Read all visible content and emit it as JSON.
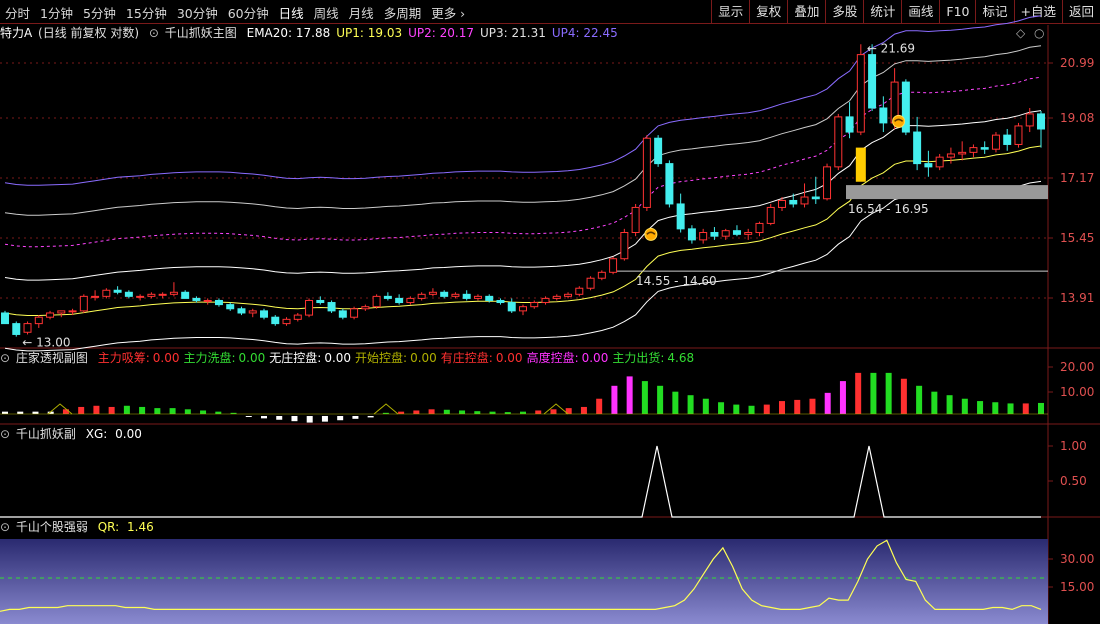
{
  "toolbar": {
    "periods": [
      "分时",
      "1分钟",
      "5分钟",
      "15分钟",
      "30分钟",
      "60分钟",
      "日线",
      "周线",
      "月线",
      "多周期",
      "更多"
    ],
    "active_period": "日线",
    "right_buttons": [
      "显示",
      "复权",
      "叠加",
      "多股",
      "统计",
      "画线",
      "F10",
      "标记",
      "+自选",
      "返回"
    ]
  },
  "main_pane": {
    "stock_label": "特力A",
    "mode": "(日线 前复权 对数)",
    "indicator_name": "千山抓妖主图",
    "legend": [
      {
        "name": "EMA20",
        "value": "17.88",
        "color": "#ffffff"
      },
      {
        "name": "UP1",
        "value": "19.03",
        "color": "#ffff55"
      },
      {
        "name": "UP2",
        "value": "20.17",
        "color": "#ff44ff"
      },
      {
        "name": "UP3",
        "value": "21.31",
        "color": "#e0e0e0"
      },
      {
        "name": "UP4",
        "value": "22.45",
        "color": "#8a6cff"
      }
    ],
    "price_axis": [
      "20.99",
      "19.08",
      "17.17",
      "15.45",
      "13.91"
    ],
    "annotations": {
      "high_label": "21.69",
      "low_label": "13.00",
      "zone1": "14.55 - 14.60",
      "zone2": "16.54 - 16.95"
    }
  },
  "pane2": {
    "name": "庄家透视副图",
    "items": [
      {
        "label": "主力吸筹",
        "value": "0.00",
        "color": "#ff3030"
      },
      {
        "label": "主力洗盘",
        "value": "0.00",
        "color": "#33dd33"
      },
      {
        "label": "无庄控盘",
        "value": "0.00",
        "color": "#ffffff"
      },
      {
        "label": "开始控盘",
        "value": "0.00",
        "color": "#b0b000"
      },
      {
        "label": "有庄控盘",
        "value": "0.00",
        "color": "#ff3030"
      },
      {
        "label": "高度控盘",
        "value": "0.00",
        "color": "#ff33ff"
      },
      {
        "label": "主力出货",
        "value": "4.68",
        "color": "#33dd33"
      }
    ],
    "axis": [
      "20.00",
      "10.00"
    ]
  },
  "pane3": {
    "name": "千山抓妖副",
    "item": {
      "label": "XG",
      "value": "0.00",
      "color": "#ffffff"
    },
    "axis": [
      "1.00",
      "0.50"
    ]
  },
  "pane4": {
    "name": "千山个股强弱",
    "item": {
      "label": "QR",
      "value": "1.46",
      "color": "#ffff55"
    },
    "axis": [
      "30.00",
      "15.00"
    ]
  },
  "colors": {
    "up_candle": "#ff3333",
    "down_candle": "#44eeee",
    "border": "#7a1a1a",
    "ema": "#ffffff"
  },
  "chart_data": {
    "type": "candlestick",
    "ohlc": [
      [
        13.55,
        13.6,
        13.3,
        13.3
      ],
      [
        13.3,
        13.35,
        13.0,
        13.05
      ],
      [
        13.1,
        13.35,
        13.05,
        13.3
      ],
      [
        13.3,
        13.5,
        13.2,
        13.45
      ],
      [
        13.45,
        13.6,
        13.4,
        13.55
      ],
      [
        13.55,
        13.6,
        13.45,
        13.6
      ],
      [
        13.6,
        13.65,
        13.5,
        13.6
      ],
      [
        13.6,
        14.0,
        13.55,
        13.95
      ],
      [
        13.95,
        14.1,
        13.85,
        13.95
      ],
      [
        13.95,
        14.15,
        13.9,
        14.1
      ],
      [
        14.1,
        14.2,
        14.0,
        14.05
      ],
      [
        14.05,
        14.1,
        13.9,
        13.95
      ],
      [
        13.95,
        14.0,
        13.85,
        13.95
      ],
      [
        13.95,
        14.05,
        13.9,
        14.0
      ],
      [
        14.0,
        14.05,
        13.9,
        14.0
      ],
      [
        14.0,
        14.3,
        13.95,
        14.05
      ],
      [
        14.05,
        14.1,
        13.9,
        13.9
      ],
      [
        13.9,
        13.95,
        13.8,
        13.85
      ],
      [
        13.85,
        13.9,
        13.75,
        13.85
      ],
      [
        13.85,
        13.9,
        13.7,
        13.75
      ],
      [
        13.75,
        13.8,
        13.6,
        13.65
      ],
      [
        13.65,
        13.7,
        13.5,
        13.55
      ],
      [
        13.55,
        13.65,
        13.45,
        13.6
      ],
      [
        13.6,
        13.65,
        13.4,
        13.45
      ],
      [
        13.45,
        13.5,
        13.25,
        13.3
      ],
      [
        13.3,
        13.45,
        13.25,
        13.4
      ],
      [
        13.4,
        13.55,
        13.35,
        13.5
      ],
      [
        13.5,
        13.9,
        13.45,
        13.85
      ],
      [
        13.85,
        13.95,
        13.75,
        13.8
      ],
      [
        13.8,
        13.85,
        13.55,
        13.6
      ],
      [
        13.6,
        13.65,
        13.4,
        13.45
      ],
      [
        13.45,
        13.7,
        13.4,
        13.65
      ],
      [
        13.65,
        13.75,
        13.6,
        13.7
      ],
      [
        13.7,
        14.0,
        13.65,
        13.95
      ],
      [
        13.95,
        14.05,
        13.85,
        13.9
      ],
      [
        13.9,
        14.0,
        13.75,
        13.8
      ],
      [
        13.8,
        13.95,
        13.75,
        13.9
      ],
      [
        13.9,
        14.05,
        13.85,
        14.0
      ],
      [
        14.0,
        14.15,
        13.95,
        14.05
      ],
      [
        14.05,
        14.1,
        13.9,
        13.95
      ],
      [
        13.95,
        14.05,
        13.9,
        14.0
      ],
      [
        14.0,
        14.1,
        13.85,
        13.9
      ],
      [
        13.9,
        14.0,
        13.85,
        13.95
      ],
      [
        13.95,
        14.0,
        13.8,
        13.85
      ],
      [
        13.85,
        13.9,
        13.75,
        13.8
      ],
      [
        13.8,
        13.9,
        13.55,
        13.6
      ],
      [
        13.6,
        13.75,
        13.5,
        13.7
      ],
      [
        13.7,
        13.85,
        13.65,
        13.8
      ],
      [
        13.8,
        13.95,
        13.75,
        13.9
      ],
      [
        13.9,
        14.0,
        13.85,
        13.95
      ],
      [
        13.95,
        14.05,
        13.9,
        14.0
      ],
      [
        14.0,
        14.2,
        13.95,
        14.15
      ],
      [
        14.15,
        14.45,
        14.1,
        14.4
      ],
      [
        14.4,
        14.6,
        14.35,
        14.55
      ],
      [
        14.55,
        14.95,
        14.5,
        14.9
      ],
      [
        14.9,
        15.7,
        14.85,
        15.6
      ],
      [
        15.6,
        16.4,
        15.5,
        16.3
      ],
      [
        16.3,
        18.5,
        16.2,
        18.4
      ],
      [
        18.4,
        18.5,
        17.5,
        17.6
      ],
      [
        17.6,
        17.7,
        16.3,
        16.4
      ],
      [
        16.4,
        16.7,
        15.6,
        15.7
      ],
      [
        15.7,
        15.8,
        15.3,
        15.4
      ],
      [
        15.4,
        15.7,
        15.3,
        15.6
      ],
      [
        15.6,
        15.75,
        15.4,
        15.5
      ],
      [
        15.5,
        15.7,
        15.4,
        15.65
      ],
      [
        15.65,
        15.8,
        15.5,
        15.55
      ],
      [
        15.55,
        15.7,
        15.4,
        15.6
      ],
      [
        15.6,
        15.9,
        15.5,
        15.85
      ],
      [
        15.85,
        16.4,
        15.8,
        16.3
      ],
      [
        16.3,
        16.6,
        16.2,
        16.5
      ],
      [
        16.5,
        16.7,
        16.3,
        16.4
      ],
      [
        16.4,
        17.0,
        16.3,
        16.6
      ],
      [
        16.6,
        17.2,
        16.4,
        16.55
      ],
      [
        16.55,
        17.6,
        16.5,
        17.5
      ],
      [
        17.5,
        19.2,
        17.4,
        19.1
      ],
      [
        19.1,
        19.6,
        18.4,
        18.6
      ],
      [
        18.6,
        21.69,
        18.5,
        21.3
      ],
      [
        21.3,
        21.69,
        19.3,
        19.4
      ],
      [
        19.4,
        19.8,
        18.6,
        18.9
      ],
      [
        18.9,
        20.8,
        18.7,
        20.3
      ],
      [
        20.3,
        20.4,
        18.5,
        18.6
      ],
      [
        18.6,
        19.1,
        17.4,
        17.6
      ],
      [
        17.6,
        18.0,
        17.2,
        17.5
      ],
      [
        17.5,
        17.9,
        17.4,
        17.8
      ],
      [
        17.8,
        18.1,
        17.6,
        17.9
      ],
      [
        17.9,
        18.3,
        17.7,
        17.95
      ],
      [
        17.95,
        18.2,
        17.8,
        18.1
      ],
      [
        18.1,
        18.3,
        17.9,
        18.05
      ],
      [
        18.05,
        18.6,
        17.95,
        18.5
      ],
      [
        18.5,
        18.7,
        18.0,
        18.2
      ],
      [
        18.2,
        18.9,
        18.1,
        18.8
      ],
      [
        18.8,
        19.4,
        18.6,
        19.2
      ],
      [
        19.2,
        19.3,
        18.1,
        18.7
      ]
    ],
    "ema20": [
      13.55,
      13.51,
      13.49,
      13.49,
      13.5,
      13.51,
      13.52,
      13.56,
      13.6,
      13.64,
      13.68,
      13.7,
      13.72,
      13.75,
      13.77,
      13.79,
      13.8,
      13.81,
      13.81,
      13.81,
      13.8,
      13.78,
      13.76,
      13.73,
      13.69,
      13.66,
      13.65,
      13.67,
      13.68,
      13.67,
      13.65,
      13.65,
      13.66,
      13.68,
      13.7,
      13.71,
      13.73,
      13.75,
      13.78,
      13.79,
      13.81,
      13.82,
      13.83,
      13.83,
      13.83,
      13.81,
      13.8,
      13.8,
      13.81,
      13.82,
      13.84,
      13.87,
      13.92,
      13.98,
      14.06,
      14.2,
      14.37,
      14.7,
      14.97,
      15.06,
      15.12,
      15.15,
      15.19,
      15.22,
      15.26,
      15.29,
      15.32,
      15.37,
      15.46,
      15.56,
      15.64,
      15.73,
      15.81,
      15.97,
      16.26,
      16.48,
      16.93,
      17.16,
      17.32,
      17.58,
      17.68,
      17.68,
      17.66,
      17.68,
      17.7,
      17.73,
      17.77,
      17.8,
      17.87,
      17.91,
      17.99,
      18.1,
      18.15
    ],
    "up_bands_multipliers": [
      1.064,
      1.128,
      1.192,
      1.256
    ],
    "pane2_bars": [
      [
        1,
        "w"
      ],
      [
        1,
        "w"
      ],
      [
        1,
        "w"
      ],
      [
        1,
        "w"
      ],
      [
        2,
        "r"
      ],
      [
        3,
        "r"
      ],
      [
        3.5,
        "r"
      ],
      [
        3,
        "r"
      ],
      [
        3.5,
        "g"
      ],
      [
        3,
        "g"
      ],
      [
        2.5,
        "g"
      ],
      [
        2.5,
        "g"
      ],
      [
        2,
        "g"
      ],
      [
        1.5,
        "g"
      ],
      [
        1,
        "g"
      ],
      [
        0.5,
        "g"
      ],
      [
        -0.3,
        "w"
      ],
      [
        -1,
        "w"
      ],
      [
        -1.6,
        "w"
      ],
      [
        -2.2,
        "w"
      ],
      [
        -2.8,
        "w"
      ],
      [
        -2.4,
        "w"
      ],
      [
        -1.8,
        "w"
      ],
      [
        -1.2,
        "w"
      ],
      [
        -0.6,
        "w"
      ],
      [
        0.5,
        "g"
      ],
      [
        1,
        "r"
      ],
      [
        1.5,
        "r"
      ],
      [
        2,
        "r"
      ],
      [
        1.8,
        "g"
      ],
      [
        1.5,
        "g"
      ],
      [
        1.2,
        "g"
      ],
      [
        1,
        "g"
      ],
      [
        0.8,
        "g"
      ],
      [
        1,
        "g"
      ],
      [
        1.5,
        "r"
      ],
      [
        2,
        "r"
      ],
      [
        2.5,
        "r"
      ],
      [
        3,
        "r"
      ],
      [
        6.5,
        "r"
      ],
      [
        12,
        "m"
      ],
      [
        16,
        "m"
      ],
      [
        14,
        "g"
      ],
      [
        12,
        "g"
      ],
      [
        9.5,
        "g"
      ],
      [
        8,
        "g"
      ],
      [
        6.5,
        "g"
      ],
      [
        5,
        "g"
      ],
      [
        4,
        "g"
      ],
      [
        3.5,
        "g"
      ],
      [
        4,
        "r"
      ],
      [
        5.5,
        "r"
      ],
      [
        6,
        "r"
      ],
      [
        6.5,
        "r"
      ],
      [
        9,
        "m"
      ],
      [
        14,
        "m"
      ],
      [
        17.5,
        "r"
      ],
      [
        17.5,
        "g"
      ],
      [
        17.5,
        "g"
      ],
      [
        15,
        "r"
      ],
      [
        12,
        "g"
      ],
      [
        9.5,
        "g"
      ],
      [
        8,
        "g"
      ],
      [
        6.5,
        "g"
      ],
      [
        5.5,
        "g"
      ],
      [
        5,
        "g"
      ],
      [
        4.5,
        "g"
      ],
      [
        4.5,
        "r"
      ],
      [
        4.7,
        "g"
      ]
    ],
    "pane4_qr": [
      2,
      3,
      3,
      4,
      4,
      4,
      4,
      5,
      5,
      5,
      5,
      5,
      5,
      4,
      4,
      4,
      3,
      3,
      3,
      3,
      3,
      3,
      3,
      3,
      3,
      3,
      3,
      3,
      3,
      3,
      3,
      3,
      3,
      3,
      3,
      3,
      3,
      3,
      3,
      3,
      3,
      3,
      3,
      3,
      3,
      3,
      3,
      3,
      3,
      3,
      3,
      3,
      3,
      3,
      3,
      3,
      3,
      3,
      3,
      3,
      3,
      3,
      3,
      3,
      3,
      3,
      3,
      3,
      3,
      4,
      5,
      8,
      14,
      22,
      30,
      36,
      26,
      14,
      8,
      5,
      4,
      3,
      3,
      3,
      4,
      5,
      9,
      8,
      8,
      18,
      30,
      37,
      40,
      28,
      19,
      18,
      8,
      3,
      3,
      3,
      3,
      3,
      3,
      4,
      4,
      3,
      5,
      5,
      3
    ]
  }
}
